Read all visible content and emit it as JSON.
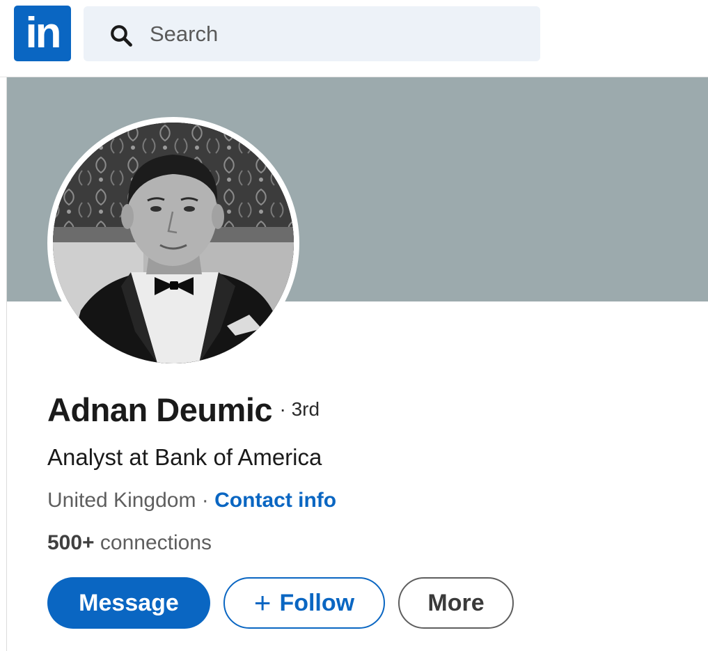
{
  "nav": {
    "logo_text": "in",
    "logo_color": "#0a66c2",
    "search": {
      "placeholder": "Search",
      "icon": "search-icon"
    }
  },
  "profile": {
    "cover_color": "#9caaad",
    "avatar": "profile-photo",
    "name": "Adnan Deumic",
    "degree": "· 3rd",
    "headline": "Analyst at Bank of America",
    "location": "United Kingdom",
    "separator": " · ",
    "contact_info_label": "Contact info",
    "connections_count": "500+",
    "connections_label": " connections"
  },
  "actions": {
    "message_label": "Message",
    "follow_plus": "+",
    "follow_label": "Follow",
    "more_label": "More"
  },
  "colors": {
    "primary": "#0a66c2",
    "text": "#1a1a1a",
    "muted": "#5e5e5e"
  }
}
